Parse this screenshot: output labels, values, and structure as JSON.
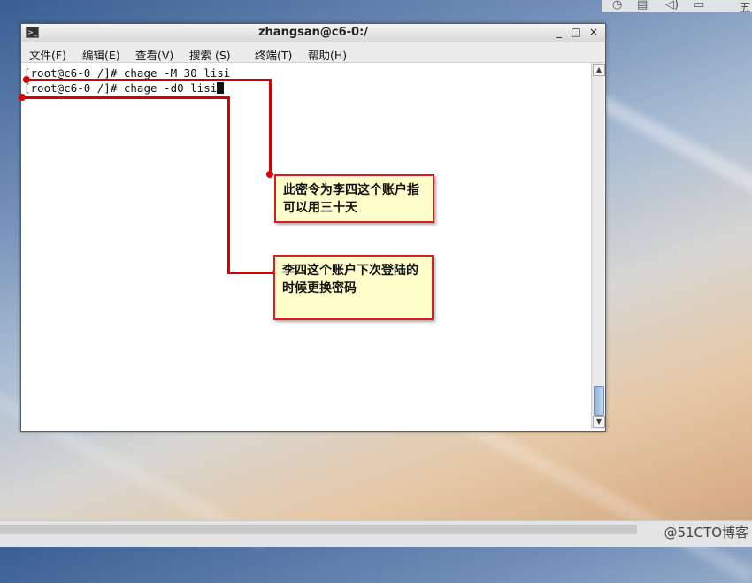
{
  "window": {
    "title": "zhangsan@c6-0:/",
    "buttons": [
      "_",
      "□",
      "×"
    ]
  },
  "menu": [
    "文件(F)",
    "编辑(E)",
    "查看(V)",
    "搜索 (S)",
    "终端(T)",
    "帮助(H)"
  ],
  "terminal": {
    "line1": "[root@c6-0 /]# chage -M 30 lisi",
    "line2": "[root@c6-0 /]# chage -d0 lisi"
  },
  "annotations": {
    "callout1": "此密令为李四这个账户指可以用三十天",
    "callout2": "李四这个账户下次登陆的时候更换密码"
  },
  "tray": {
    "top_right_char": "五"
  },
  "watermark": "@51CTO博客"
}
